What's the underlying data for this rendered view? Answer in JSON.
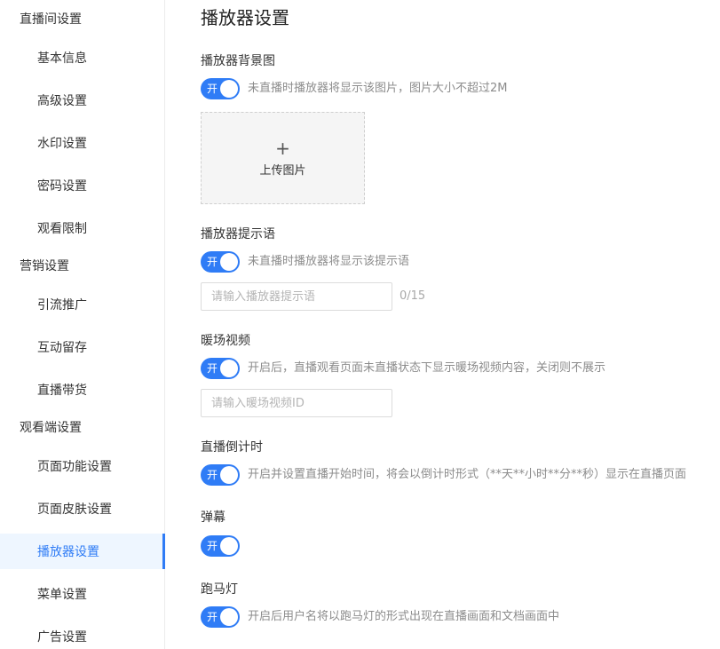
{
  "sidebar": {
    "groups": [
      {
        "title": "直播间设置",
        "items": [
          "基本信息",
          "高级设置",
          "水印设置",
          "密码设置",
          "观看限制"
        ]
      },
      {
        "title": "营销设置",
        "items": [
          "引流推广",
          "互动留存",
          "直播带货"
        ]
      },
      {
        "title": "观看端设置",
        "items": [
          "页面功能设置",
          "页面皮肤设置",
          "播放器设置",
          "菜单设置",
          "广告设置"
        ]
      }
    ],
    "active_item": "播放器设置"
  },
  "main": {
    "title": "播放器设置",
    "toggle_on_label": "开",
    "sections": {
      "background": {
        "label": "播放器背景图",
        "hint": "未直播时播放器将显示该图片，图片大小不超过2M",
        "upload_plus": "+",
        "upload_text": "上传图片",
        "enabled": true
      },
      "tip": {
        "label": "播放器提示语",
        "hint": "未直播时播放器将显示该提示语",
        "placeholder": "请输入播放器提示语",
        "value": "",
        "counter": "0/15",
        "enabled": true
      },
      "warmup": {
        "label": "暖场视频",
        "hint": "开启后，直播观看页面未直播状态下显示暖场视频内容，关闭则不展示",
        "placeholder": "请输入暖场视频ID",
        "value": "",
        "enabled": true
      },
      "countdown": {
        "label": "直播倒计时",
        "hint": "开启并设置直播开始时间，将会以倒计时形式（**天**小时**分**秒）显示在直播页面",
        "enabled": true
      },
      "danmaku": {
        "label": "弹幕",
        "enabled": true
      },
      "marquee": {
        "label": "跑马灯",
        "hint": "开启后用户名将以跑马灯的形式出现在直播画面和文档画面中",
        "enabled": true
      }
    }
  },
  "colors": {
    "accent": "#2f7cf6",
    "active_bg": "#eef6ff"
  }
}
